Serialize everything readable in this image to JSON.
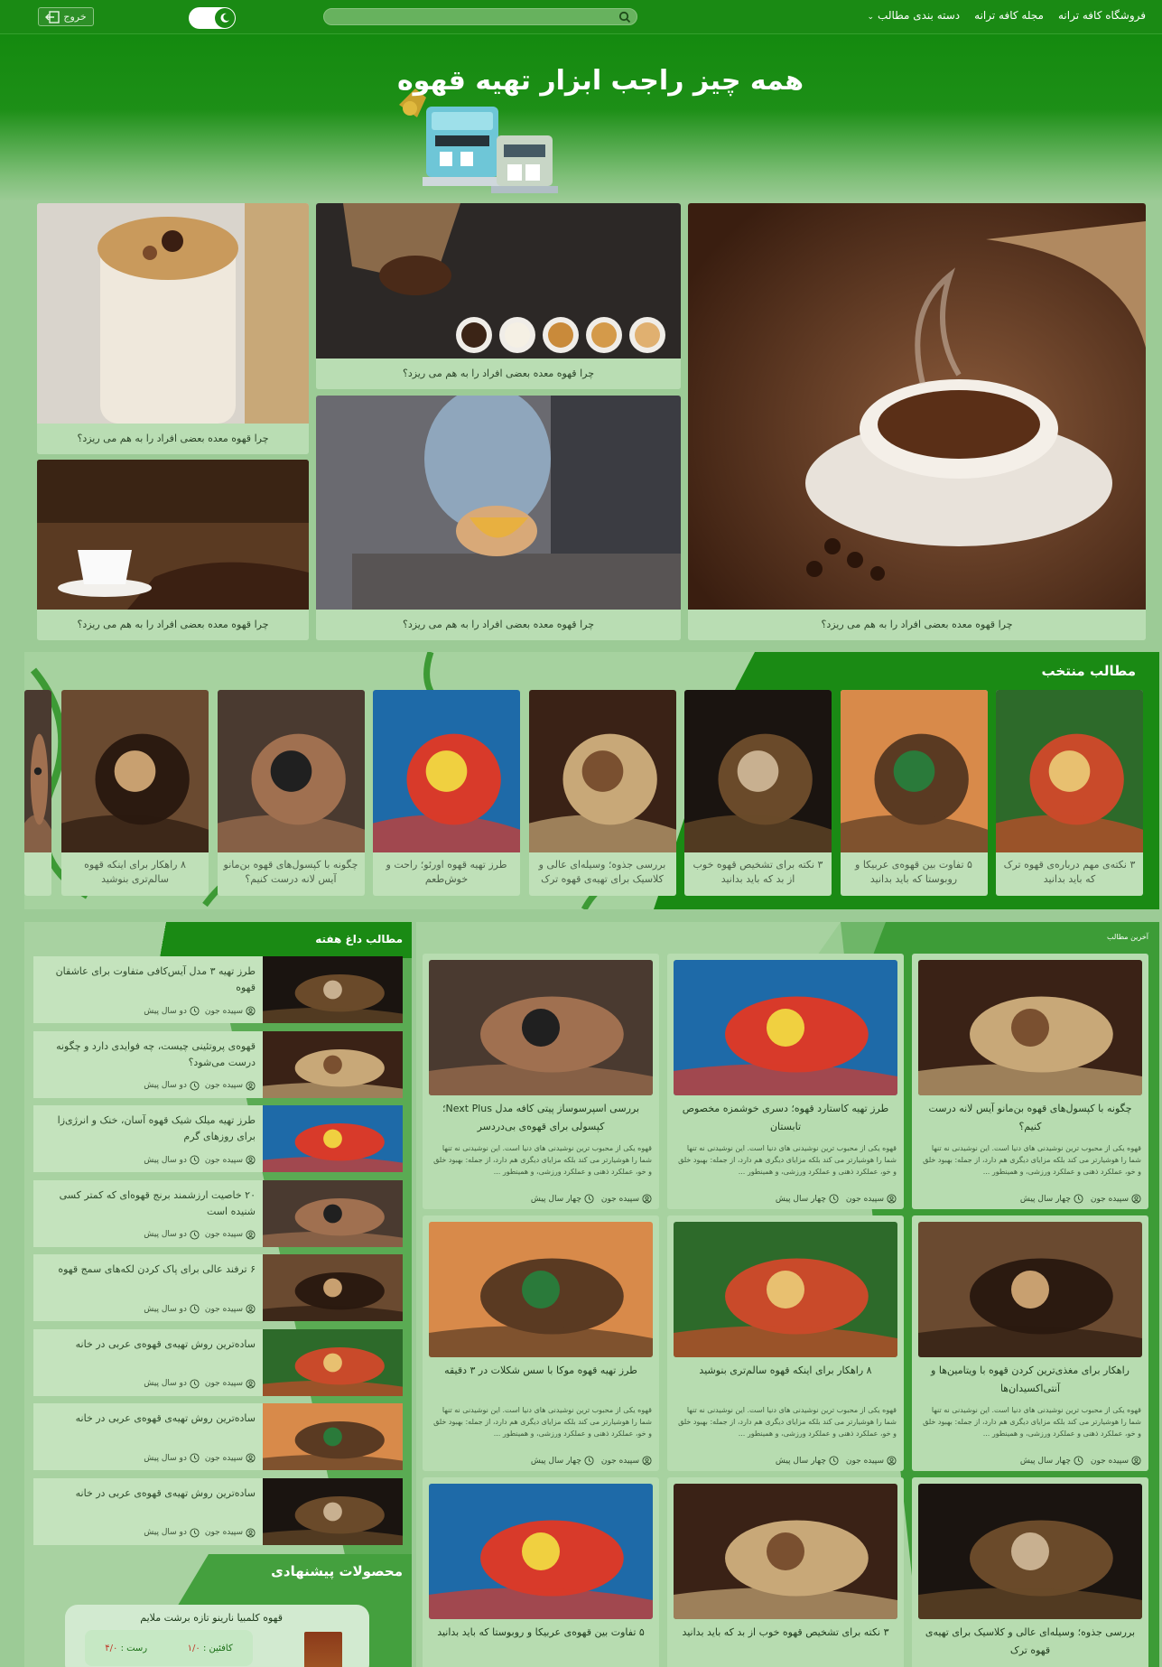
{
  "nav": {
    "links": [
      "فروشگاه کافه ترانه",
      "مجله کافه ترانه",
      "دسته بندی مطالب"
    ],
    "search_placeholder": "",
    "logout_label": "خروج"
  },
  "hero": {
    "title": "همه چیز راجب ابزار تهیه قهوه"
  },
  "featured": {
    "tiles": [
      {
        "caption": "چرا قهوه معده بعضی افراد را به هم می ریزد؟",
        "image": "coffee-cup-steam-burlap"
      },
      {
        "caption": "چرا قهوه معده بعضی افراد را به هم می ریزد؟",
        "image": "coffee-beans-scoop-cups"
      },
      {
        "caption": "چرا قهوه معده بعضی افراد را به هم می ریزد؟",
        "image": "woman-holding-yellow-cup"
      },
      {
        "caption": "چرا قهوه معده بعضی افراد را به هم می ریزد؟",
        "image": "oats-granola-jar"
      },
      {
        "caption": "چرا قهوه معده بعضی افراد را به هم می ریزد؟",
        "image": "white-cup-on-beans"
      }
    ]
  },
  "picks": {
    "title": "مطالب منتخب",
    "items": [
      {
        "title": "۳ نکته‌ی مهم درباره‌ی قهوه ترک که باید بدانید",
        "image": "coffee-harvest-painting"
      },
      {
        "title": "۵ تفاوت بین قهوه‌ی عربیکا و روبوستا که باید بدانید",
        "image": "farmer-illustration"
      },
      {
        "title": "۳ نکته برای تشخیص قهوه خوب از بد که باید بدانید",
        "image": "espresso-glass"
      },
      {
        "title": "بررسی جذوه؛ وسیله‌ای عالی و کلاسیک برای تهیه‌ی قهوه ترک",
        "image": "blue-mountain-coffee-tub"
      },
      {
        "title": "طرز تهیه قهوه اورئو؛ راحت و خوش‌طعم",
        "image": "colorful-mural"
      },
      {
        "title": "چگونه با کپسول‌های قهوه بن‌مانو آیس لانه درست کنیم؟",
        "image": "barista-espresso-machine"
      },
      {
        "title": "۸ راهکار برای اینکه قهوه سالم‌تری بنوشید",
        "image": "grinder-and-beans"
      }
    ]
  },
  "weekly": {
    "title": "مطالب داغ هفته",
    "items": [
      {
        "title": "طرز تهیه ۳ مدل آیس‌کافی متفاوت برای عاشقان قهوه",
        "author": "سپیده جون",
        "time": "دو سال پیش",
        "image": "ground-coffee"
      },
      {
        "title": "قهوه‌ی پروتئینی چیست، چه فوایدی دارد و چگونه درست می‌شود؟",
        "author": "سپیده جون",
        "time": "دو سال پیش",
        "image": "beans-scoop"
      },
      {
        "title": "طرز تهیه میلک شیک قهوه آسان، خنک و انرژی‌زا برای روزهای گرم",
        "author": "سپیده جون",
        "time": "دو سال پیش",
        "image": "coffee-cherries"
      },
      {
        "title": "۲۰ خاصیت ارزشمند برنج قهوه‌ای که کمتر کسی شنیده است",
        "author": "سپیده جون",
        "time": "دو سال پیش",
        "image": "red-berries"
      },
      {
        "title": "۶ ترفند عالی برای پاک کردن لکه‌های سمج قهوه",
        "author": "سپیده جون",
        "time": "دو سال پیش",
        "image": "bean-bowls"
      },
      {
        "title": "ساده‌ترین روش تهیه‌ی قهوه‌ی عربی در خانه",
        "author": "سپیده جون",
        "time": "دو سال پیش",
        "image": "woman-smiling-cup"
      },
      {
        "title": "ساده‌ترین روش تهیه‌ی قهوه‌ی عربی در خانه",
        "author": "سپیده جون",
        "time": "دو سال پیش",
        "image": "hands-with-cup"
      },
      {
        "title": "ساده‌ترین روش تهیه‌ی قهوه‌ی عربی در خانه",
        "author": "سپیده جون",
        "time": "دو سال پیش",
        "image": "espresso-cups"
      }
    ]
  },
  "latest": {
    "title": "آخرین مطالب",
    "posts": [
      {
        "title": "چگونه با کپسول‌های قهوه بن‌مانو آیس لانه درست کنیم؟",
        "author": "سپیده جون",
        "time": "چهار سال پیش",
        "image": "espresso-machine-cups"
      },
      {
        "title": "طرز تهیه کاستارد قهوه؛ دسری خوشمزه مخصوص تابستان",
        "author": "سپیده جون",
        "time": "چهار سال پیش",
        "image": "cup-on-burlap"
      },
      {
        "title": "بررسی اسپرسوساز پیتی کافه مدل Next Plus؛ کپسولی برای قهوه‌ی بی‌دردسر",
        "author": "سپیده جون",
        "time": "چهار سال پیش",
        "image": "heart-steam-cup"
      },
      {
        "title": "راهکار برای مغذی‌ترین کردن قهوه با ویتامین‌ها و آنتی‌اکسیدان‌ها",
        "author": "سپیده جون",
        "time": "چهار سال پیش",
        "image": "cup-on-wood-beans"
      },
      {
        "title": "۸ راهکار برای اینکه قهوه سالم‌تری بنوشید",
        "author": "سپیده جون",
        "time": "چهار سال پیش",
        "image": "espresso-pouring"
      },
      {
        "title": "طرز تهیه قهوه موکا با سس شکلات در ۳ دقیقه",
        "author": "سپیده جون",
        "time": "چهار سال پیش",
        "image": "hands-cup-book"
      },
      {
        "title": "بررسی جذوه؛ وسیله‌ای عالی و کلاسیک برای تهیه‌ی قهوه ترک",
        "author": "",
        "time": "",
        "image": "table-cups-top"
      },
      {
        "title": "۳ نکته برای تشخیص قهوه خوب از بد که باید بدانید",
        "author": "",
        "time": "",
        "image": "croissant-cup"
      },
      {
        "title": "۵ تفاوت بین قهوه‌ی عربیکا و روبوستا که باید بدانید",
        "author": "",
        "time": "",
        "image": "spoon-beans-dark"
      }
    ],
    "excerpt": "قهوه یکی از محبوب ترین نوشیدنی های دنیا است. این نوشیدنی نه تنها شما را هوشیارتر می کند بلکه مزایای دیگری هم دارد، از جمله: بهبود خلق و خو، عملکرد ذهنی و عملکرد ورزشی، و همینطور ..."
  },
  "recommended": {
    "title": "محصولات پیشنهادی",
    "product_name": "قهوه کلمبیا نارینو تازه برشت ملایم",
    "attr1_label": "کافئین :",
    "attr1_value": "۱/۰",
    "attr2_label": "رست :",
    "attr2_value": "۴/۰"
  },
  "colors": {
    "primary": "#1a8a14",
    "page": "#9ccb96",
    "card": "#b7dcb0"
  }
}
